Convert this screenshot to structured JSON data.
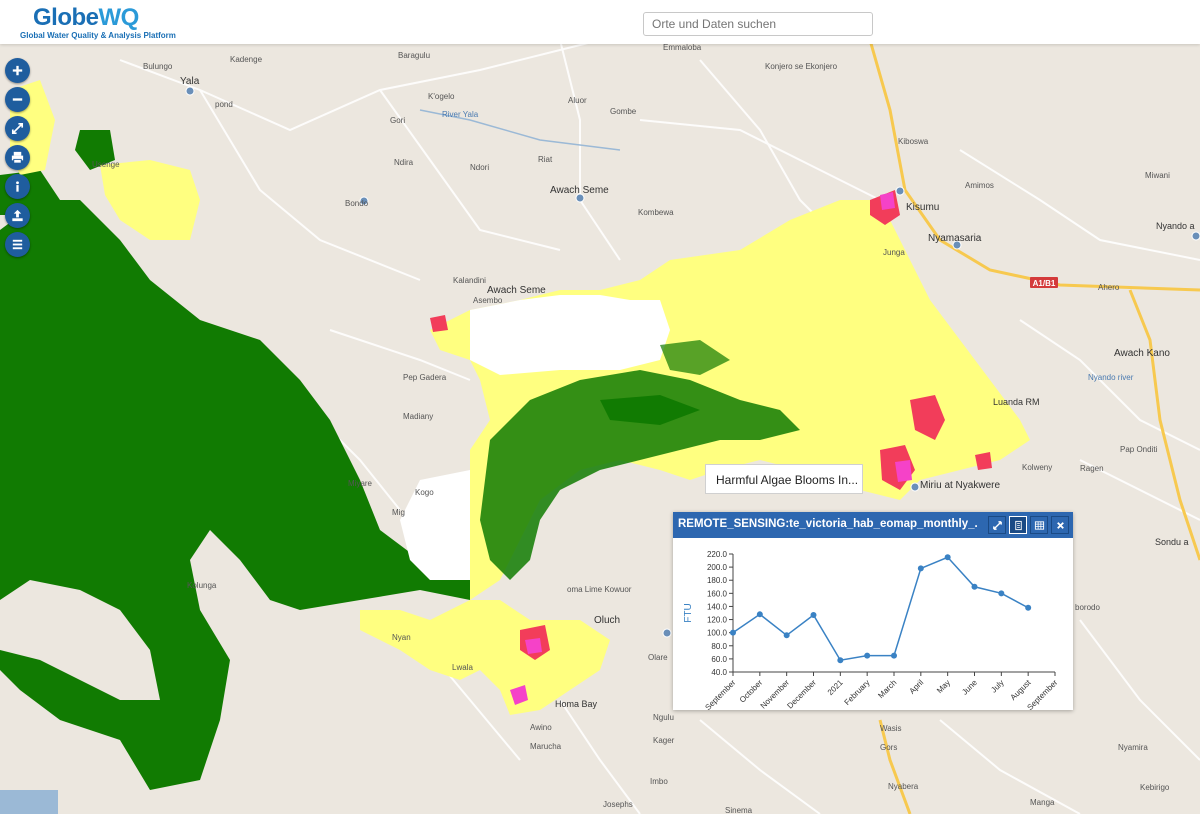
{
  "header": {
    "logo_main_a": "Globe",
    "logo_main_b": "WQ",
    "logo_sub": "Global Water Quality & Analysis Platform",
    "search_placeholder": "Orte und Daten suchen"
  },
  "toolbar": {
    "items": [
      "plus-icon",
      "minus-icon",
      "expand-icon",
      "print-icon",
      "info-icon",
      "upload-icon",
      "layers-icon"
    ]
  },
  "map": {
    "colors": {
      "land": "#ece7df",
      "hab_low": "#ffff80",
      "hab_vegetation": "#117b02",
      "hab_high": "#f23d5a",
      "hab_extreme": "#f542c8",
      "water_river": "#9bb9d6",
      "road": "#f7c94f"
    },
    "places": [
      "Bulungo",
      "Kadenge",
      "Baragulu",
      "Yala",
      "pond",
      "K'ogelo",
      "River Yala",
      "Gori",
      "Aluor",
      "Gombe",
      "Usenge",
      "Ndira",
      "Ndori",
      "Riat",
      "Bondo",
      "Awach Seme",
      "Kombewa",
      "Kalandini",
      "Awach Seme",
      "Asembo",
      "Pep Gadera",
      "Madiany",
      "Miyare",
      "Kogo",
      "Mig",
      "Kolunga",
      "Nyan",
      "Lwala",
      "Homa Bay",
      "Ngulu",
      "Awino",
      "Kager",
      "Marucha",
      "Imbo",
      "Josephs",
      "Sinema",
      "Wasis",
      "Gors",
      "Nyabera",
      "Manga",
      "Kebirigo",
      "Nyamira",
      "Emmaloba",
      "Konjero se Ekonjero",
      "Kiboswa",
      "Kisumu",
      "Amimos",
      "Miwani",
      "Nyamasaria",
      "Junga",
      "Nyando a",
      "Ahero",
      "Awach Kano",
      "Nyando river",
      "Pap Onditi",
      "Kolweny",
      "Ragen",
      "Sondu a",
      "Luanda RM",
      "Miriu at Nyakwere",
      "oma Lime Kowuor",
      "Oluch",
      "Olare",
      "borodo"
    ],
    "road_badge": "A1/B1"
  },
  "tooltip": {
    "text": "Harmful Algae Blooms In..."
  },
  "panel": {
    "title": "REMOTE_SENSING:te_victoria_hab_eomap_monthly_...",
    "buttons": [
      "collapse-icon",
      "document-icon",
      "table-icon",
      "close-icon"
    ]
  },
  "chart_data": {
    "type": "line",
    "ylabel": "FTU",
    "ylim": [
      40,
      220
    ],
    "yticks": [
      "40.0",
      "60.0",
      "80.0",
      "100.0",
      "120.0",
      "140.0",
      "160.0",
      "180.0",
      "200.0",
      "220.0"
    ],
    "categories": [
      "September",
      "October",
      "November",
      "December",
      "2021",
      "February",
      "March",
      "April",
      "May",
      "June",
      "July",
      "August",
      "September"
    ],
    "values": [
      100,
      128,
      96,
      127,
      58,
      65,
      65,
      198,
      215,
      170,
      160,
      138,
      null
    ],
    "grid": false,
    "line_color": "#3a82c4"
  }
}
